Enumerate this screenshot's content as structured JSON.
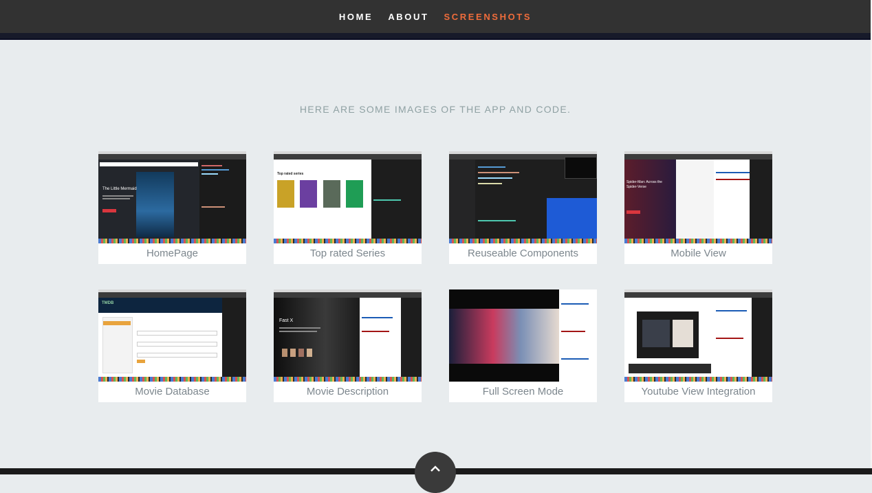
{
  "nav": {
    "items": [
      {
        "label": "HOME",
        "active": false
      },
      {
        "label": "ABOUT",
        "active": false
      },
      {
        "label": "SCREENSHOTS",
        "active": true
      }
    ]
  },
  "section": {
    "heading": "HERE ARE SOME IMAGES OF THE APP AND CODE."
  },
  "gallery": [
    {
      "caption": "HomePage"
    },
    {
      "caption": "Top rated Series"
    },
    {
      "caption": "Reuseable Components"
    },
    {
      "caption": "Mobile View"
    },
    {
      "caption": "Movie Database"
    },
    {
      "caption": "Movie Description"
    },
    {
      "caption": "Full Screen Mode"
    },
    {
      "caption": "Youtube View Integration"
    }
  ],
  "thumbnails": {
    "homepage_title": "The Little Mermaid",
    "mobile_title": "Spider-Man: Across the Spider-Verse",
    "description_title": "Fast X",
    "series_heading": "Top rated series",
    "tmdb_logo": "TMDB"
  },
  "colors": {
    "navbar": "#323232",
    "accent": "#ef6c3b",
    "background": "#e8ecee",
    "caption_text": "#7c868d"
  },
  "icons": {
    "back_to_top": "chevron-up-icon"
  }
}
